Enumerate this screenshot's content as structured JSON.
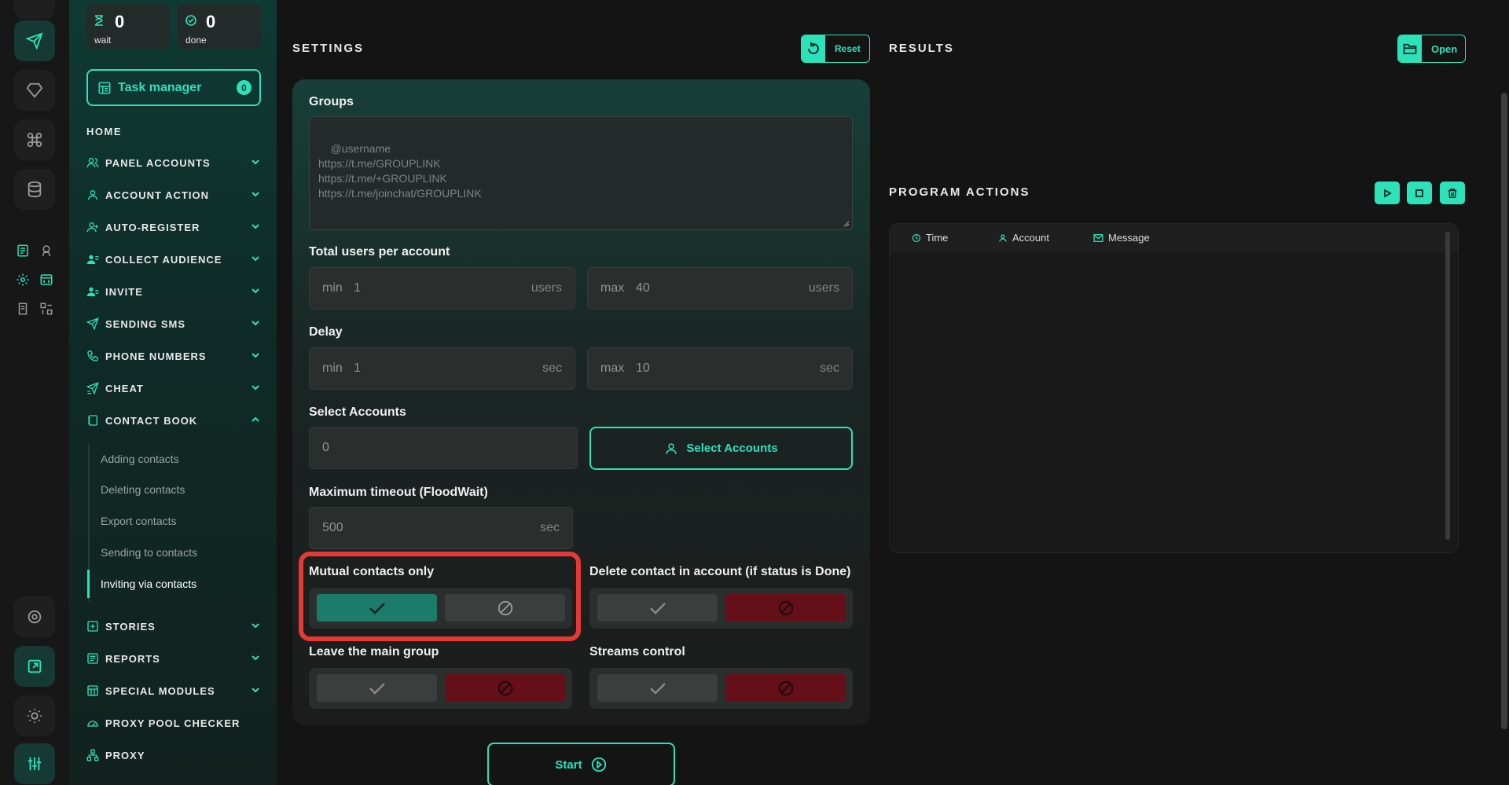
{
  "stats": {
    "wait": {
      "value": "0",
      "label": "wait"
    },
    "done": {
      "value": "0",
      "label": "done"
    }
  },
  "task_manager": {
    "label": "Task manager",
    "count": "0"
  },
  "sidebar": {
    "home": "HOME",
    "items": [
      {
        "label": "PANEL ACCOUNTS"
      },
      {
        "label": "ACCOUNT ACTION"
      },
      {
        "label": "AUTO-REGISTER"
      },
      {
        "label": "COLLECT AUDIENCE"
      },
      {
        "label": "INVITE"
      },
      {
        "label": "SENDING SMS"
      },
      {
        "label": "PHONE NUMBERS"
      },
      {
        "label": "CHEAT"
      },
      {
        "label": "CONTACT BOOK"
      },
      {
        "label": "STORIES"
      },
      {
        "label": "REPORTS"
      },
      {
        "label": "SPECIAL MODULES"
      },
      {
        "label": "PROXY POOL CHECKER"
      },
      {
        "label": "PROXY"
      }
    ],
    "contact_book_sub": [
      "Adding contacts",
      "Deleting contacts",
      "Export contacts",
      "Sending to contacts",
      "Inviting via contacts"
    ]
  },
  "settings": {
    "title": "SETTINGS",
    "reset": "Reset",
    "groups": {
      "label": "Groups",
      "placeholder": "@username\nhttps://t.me/GROUPLINK\nhttps://t.me/+GROUPLINK\nhttps://t.me/joinchat/GROUPLINK"
    },
    "users": {
      "label": "Total users per account",
      "min_prefix": "min",
      "min_value": "1",
      "max_prefix": "max",
      "max_value": "40",
      "unit": "users"
    },
    "delay": {
      "label": "Delay",
      "min_prefix": "min",
      "min_value": "1",
      "max_prefix": "max",
      "max_value": "10",
      "unit": "sec"
    },
    "accounts": {
      "label": "Select Accounts",
      "value": "0",
      "button": "Select Accounts"
    },
    "timeout": {
      "label": "Maximum timeout (FloodWait)",
      "value": "500",
      "unit": "sec"
    },
    "mutual": {
      "label": "Mutual contacts only",
      "state": "yes"
    },
    "delete_contact": {
      "label": "Delete contact in account (if status is Done)",
      "state": "no"
    },
    "leave_group": {
      "label": "Leave the main group",
      "state": "no"
    },
    "streams": {
      "label": "Streams control",
      "state": "no"
    },
    "start": "Start"
  },
  "results": {
    "title": "RESULTS",
    "open": "Open"
  },
  "program_actions": {
    "title": "PROGRAM ACTIONS",
    "columns": [
      "Time",
      "Account",
      "Message"
    ]
  },
  "colors": {
    "accent": "#2de1b9",
    "danger": "#650f18",
    "success": "#1d7b69",
    "highlight": "#e53935"
  }
}
